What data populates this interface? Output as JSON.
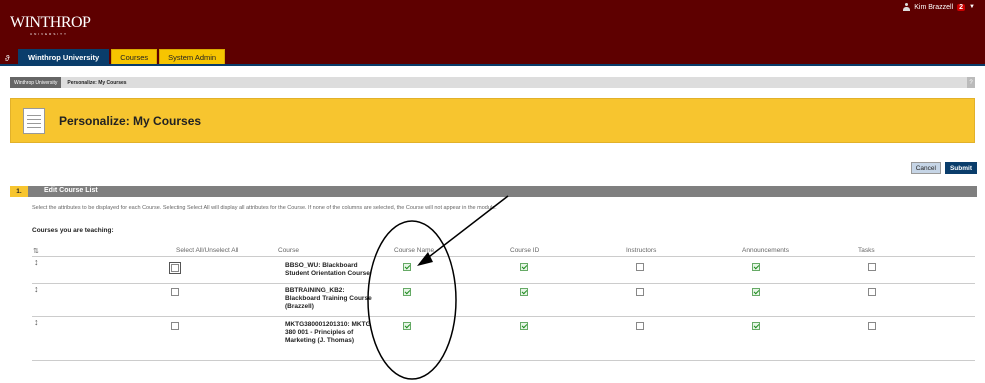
{
  "header": {
    "logo_text": "WINTHROP",
    "logo_sub": "UNIVERSITY",
    "user_name": "Kim Brazzell",
    "notification_count": "2"
  },
  "tabs": {
    "institution": "Winthrop University",
    "courses": "Courses",
    "system_admin": "System Admin"
  },
  "breadcrumb": {
    "item1": "Winthrop University",
    "item2": "Personalize: My Courses",
    "help": "?"
  },
  "page": {
    "title": "Personalize: My Courses"
  },
  "actions": {
    "cancel": "Cancel",
    "submit": "Submit"
  },
  "step": {
    "number": "1.",
    "title": "Edit Course List",
    "instructions": "Select the attributes to be displayed for each Course. Selecting Select All will display all attributes for the Course. If none of the columns are selected, the Course will not appear in the module.",
    "section_title": "Courses you are teaching:"
  },
  "table": {
    "headers": {
      "select_all": "Select All/Unselect All",
      "course": "Course",
      "course_name": "Course Name",
      "course_id": "Course ID",
      "instructors": "Instructors",
      "announcements": "Announcements",
      "tasks": "Tasks"
    },
    "rows": [
      {
        "course": "BBSO_WU: Blackboard Student Orientation Course",
        "select_all": false,
        "course_name": true,
        "course_id": true,
        "instructors": false,
        "announcements": true,
        "tasks": false
      },
      {
        "course": "BBTRAINING_KB2: Blackboard Training Course (Brazzell)",
        "select_all": false,
        "course_name": true,
        "course_id": true,
        "instructors": false,
        "announcements": true,
        "tasks": false
      },
      {
        "course": "MKTG380001201310: MKTG 380 001 - Principles of Marketing (J. Thomas)",
        "select_all": false,
        "course_name": true,
        "course_id": true,
        "instructors": false,
        "announcements": true,
        "tasks": false
      }
    ]
  },
  "icons": {
    "user": "user-icon",
    "quicklinks": "quicklinks-icon",
    "sort": "sort-icon",
    "drag": "drag-handle-icon",
    "page": "page-icon"
  },
  "colors": {
    "header_bg": "#5e0000",
    "tab_active": "#0a3d6b",
    "tab_yellow": "#f7c500",
    "page_header": "#f7c52f",
    "step_bar": "#7f7f7f",
    "submit": "#0a3d6b"
  }
}
